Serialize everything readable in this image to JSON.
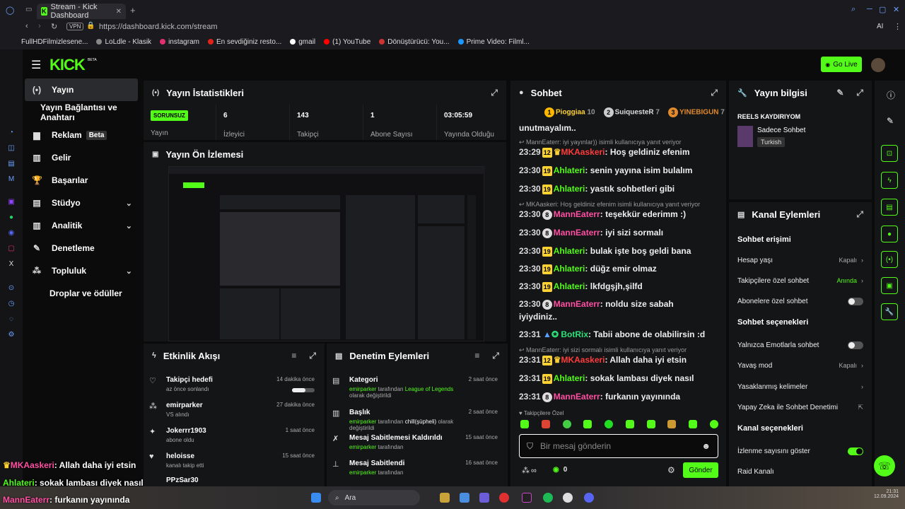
{
  "browser": {
    "tab_title": "Stream - Kick Dashboard",
    "url": "https://dashboard.kick.com/stream",
    "vpn": "VPN",
    "bookmarks": [
      "FullHDFilmizlesene...",
      "LoLdle - Klasik",
      "instagram",
      "En sevdiğiniz resto...",
      "gmail",
      "(1) YouTube",
      "Dönüştürücü: You...",
      "Prime Video: Filml..."
    ],
    "ai_label": "AI"
  },
  "header": {
    "logo": "KICK",
    "logo_sup": "BETA",
    "go_live": "Go Live"
  },
  "sidebar": {
    "items": [
      {
        "label": "Yayın",
        "icon": "broadcast-icon"
      },
      {
        "label": "Yayın Bağlantısı ve Anahtarı"
      },
      {
        "label": "Reklam",
        "badge": "Beta",
        "icon": "ad-icon"
      },
      {
        "label": "Gelir",
        "icon": "revenue-icon"
      },
      {
        "label": "Başarılar",
        "icon": "trophy-icon"
      },
      {
        "label": "Stüdyo",
        "icon": "studio-icon"
      },
      {
        "label": "Analitik",
        "icon": "analytics-icon"
      },
      {
        "label": "Denetleme",
        "icon": "moderation-icon"
      },
      {
        "label": "Topluluk",
        "icon": "community-icon"
      },
      {
        "label": "Droplar ve ödüller"
      }
    ]
  },
  "stats": {
    "title": "Yayın İstatistikleri",
    "status": "SORUNSUZ",
    "status_label": "Yayın",
    "viewers": "6",
    "viewers_label": "İzleyici",
    "followers": "143",
    "followers_label": "Takipçi",
    "subs": "1",
    "subs_label": "Abone Sayısı",
    "uptime": "03:05:59",
    "uptime_label": "Yayında Olduğu"
  },
  "preview": {
    "title": "Yayın Ön İzlemesi"
  },
  "activity": {
    "title": "Etkinlik Akışı",
    "items": [
      {
        "title": "Takipçi hedefi",
        "sub": "az önce sonlandı",
        "time": "14 dakika önce"
      },
      {
        "title": "emirparker",
        "sub": "VS alındı",
        "time": "27 dakika önce"
      },
      {
        "title": "Jokerrr1903",
        "sub": "abone oldu",
        "time": "1 saat önce"
      },
      {
        "title": "heloisse",
        "sub": "kanalı takip etti",
        "time": "15 saat önce"
      },
      {
        "title": "PPzSar30",
        "sub": "",
        "time": ""
      }
    ]
  },
  "modlog": {
    "title": "Denetim Eylemleri",
    "items": [
      {
        "title": "Kategori",
        "user": "emirparker",
        "mid": "tarafından",
        "hl": "League of Legends",
        "tail": "olarak değiştirildi",
        "time": "2 saat önce"
      },
      {
        "title": "Başlık",
        "user": "emirparker",
        "mid": "tarafından",
        "hl": "chill(şüpheli)",
        "tail": "olarak değiştirildi",
        "time": "2 saat önce"
      },
      {
        "title": "Mesaj Sabitlemesi Kaldırıldı",
        "user": "emirparker",
        "mid": "tarafından",
        "hl": "",
        "tail": "",
        "time": "15 saat önce"
      },
      {
        "title": "Mesaj Sabitlendi",
        "user": "emirparker",
        "mid": "tarafından",
        "hl": "",
        "tail": "",
        "time": "16 saat önce"
      }
    ]
  },
  "chat": {
    "title": "Sohbet",
    "top_gifters": [
      {
        "rank": "1",
        "name": "Pioggiaa",
        "count": "10"
      },
      {
        "rank": "2",
        "name": "SuiquesteR",
        "count": "7"
      },
      {
        "rank": "3",
        "name": "YINEBIGUN",
        "count": "7"
      }
    ],
    "lines": [
      {
        "type": "text",
        "text": "unutmayalım.."
      },
      {
        "type": "reply",
        "text": "MannEaterr: iyi yayınlar)) isimli kullanıcıya yanıt veriyor"
      },
      {
        "type": "msg",
        "ts": "23:29",
        "badge": "12",
        "user": "MKAaskeri",
        "ucolor": "red",
        "msg": "Hoş geldiniz efenim"
      },
      {
        "type": "msg",
        "ts": "23:30",
        "badge": "19",
        "user": "Ahlateri",
        "ucolor": "green",
        "msg": "senin yayına isim bulalım"
      },
      {
        "type": "msg",
        "ts": "23:30",
        "badge": "19",
        "user": "Ahlateri",
        "ucolor": "green",
        "msg": "yastık sohbetleri gibi"
      },
      {
        "type": "reply",
        "text": "MKAaskeri: Hoş geldiniz efenim isimli kullanıcıya yanıt veriyor"
      },
      {
        "type": "msg",
        "ts": "23:30",
        "badge": "8",
        "user": "MannEaterr",
        "ucolor": "pink",
        "msg": "teşekkür ederimm :)"
      },
      {
        "type": "msg",
        "ts": "23:30",
        "badge": "8",
        "user": "MannEaterr",
        "ucolor": "pink",
        "msg": "iyi sizi sormalı"
      },
      {
        "type": "msg",
        "ts": "23:30",
        "badge": "19",
        "user": "Ahlateri",
        "ucolor": "green",
        "msg": "bulak işte boş geldi bana"
      },
      {
        "type": "msg",
        "ts": "23:30",
        "badge": "19",
        "user": "Ahlateri",
        "ucolor": "green",
        "msg": "düğz emir olmaz"
      },
      {
        "type": "msg",
        "ts": "23:30",
        "badge": "19",
        "user": "Ahlateri",
        "ucolor": "green",
        "msg": "lkfdgşjh,şilfd"
      },
      {
        "type": "msg",
        "ts": "23:30",
        "badge": "8",
        "user": "MannEaterr",
        "ucolor": "pink",
        "msg": "noldu size sabah"
      },
      {
        "type": "text",
        "text": "iyiydiniz.."
      },
      {
        "type": "msg",
        "ts": "23:31",
        "badge": "",
        "user": "BotRix",
        "ucolor": "teal",
        "msg": "Tabii abone de olabilirsin :d"
      },
      {
        "type": "reply",
        "text": "MannEaterr: iyi sizi sormalı isimli kullanıcıya yanıt veriyor"
      },
      {
        "type": "msg",
        "ts": "23:31",
        "badge": "12",
        "user": "MKAaskeri",
        "ucolor": "red",
        "msg": "Allah daha iyi etsin"
      },
      {
        "type": "msg",
        "ts": "23:31",
        "badge": "19",
        "user": "Ahlateri",
        "ucolor": "green",
        "msg": "sokak lambası diyek nasıl"
      },
      {
        "type": "msg",
        "ts": "23:31",
        "badge": "8",
        "user": "MannEaterr",
        "ucolor": "pink",
        "msg": "furkanın yayınında"
      }
    ],
    "followers_only": "Takipçilere Özel",
    "input_placeholder": "Bir mesaj gönderin",
    "infinity": "∞",
    "points": "0",
    "send": "Gönder"
  },
  "streaminfo": {
    "title": "Yayın bilgisi",
    "stream_title": "REELS KAYDIRIYOM",
    "category": "Sadece Sohbet",
    "language": "Turkish"
  },
  "channel_actions": {
    "title": "Kanal Eylemleri",
    "chat_access_title": "Sohbet erişimi",
    "account_age": "Hesap yaşı",
    "account_age_val": "Kapalı",
    "followers_chat": "Takipçilere özel sohbet",
    "followers_chat_val": "Anında",
    "subs_chat": "Abonelere özel sohbet",
    "chat_options_title": "Sohbet seçenekleri",
    "emotes_only": "Yalnızca Emotlarla sohbet",
    "slow_mode": "Yavaş mod",
    "slow_mode_val": "Kapalı",
    "banned_words": "Yasaklanmış kelimeler",
    "ai_moderation": "Yapay Zeka ile Sohbet Denetimi",
    "channel_options_title": "Kanal seçenekleri",
    "show_viewers": "İzlenme sayısını göster",
    "raid": "Raid Kanalı"
  },
  "overlay": {
    "lines": [
      {
        "user": "MKAaskeri",
        "msg": ": Allah daha iyi etsin"
      },
      {
        "user": "Ahlateri",
        "msg": ": sokak lambası diyek nasıl"
      },
      {
        "user": "MannEaterr",
        "msg": ": furkanın yayınında"
      }
    ]
  },
  "taskbar": {
    "search": "Ara",
    "time": "21:31",
    "date": "12.09.2024"
  }
}
